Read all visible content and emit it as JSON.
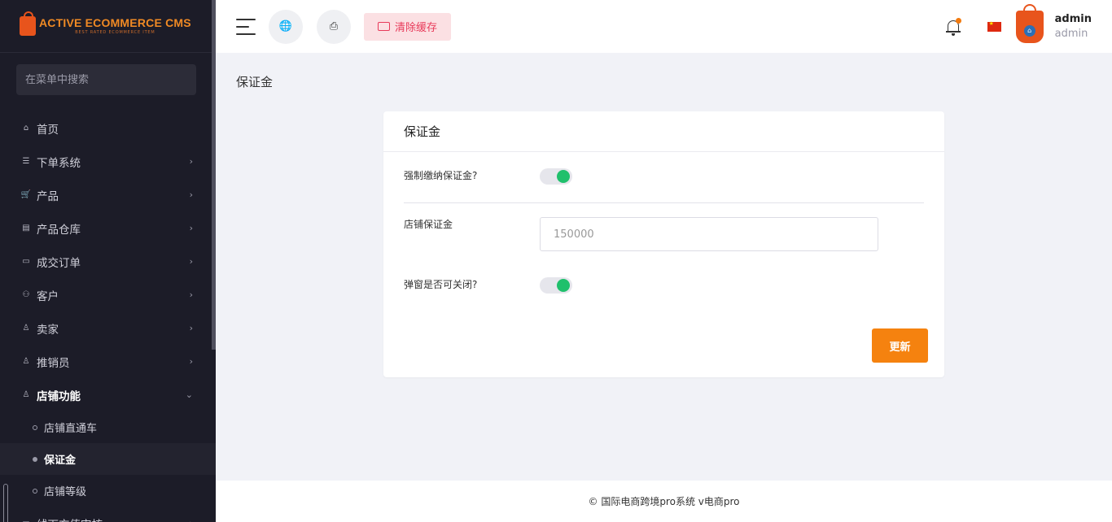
{
  "brand": {
    "title": "ACTIVE ECOMMERCE CMS",
    "tagline": "BEST RATED ECOMMERCE ITEM"
  },
  "sidebar": {
    "search_placeholder": "在菜单中搜索",
    "items": [
      {
        "label": "首页",
        "icon": "home-icon"
      },
      {
        "label": "下单系统",
        "icon": "list-icon"
      },
      {
        "label": "产品",
        "icon": "cart-icon"
      },
      {
        "label": "产品仓库",
        "icon": "warehouse-icon"
      },
      {
        "label": "成交订单",
        "icon": "money-icon"
      },
      {
        "label": "客户",
        "icon": "users-icon"
      },
      {
        "label": "卖家",
        "icon": "user-icon"
      },
      {
        "label": "推销员",
        "icon": "user-icon"
      },
      {
        "label": "店铺功能",
        "icon": "user-icon"
      },
      {
        "label": "线下充值审核",
        "icon": "money-icon"
      }
    ],
    "sub_items": [
      {
        "label": "店铺直通车"
      },
      {
        "label": "保证金"
      },
      {
        "label": "店铺等级"
      }
    ]
  },
  "header": {
    "clear_cache_label": "清除缓存",
    "user_name": "admin",
    "user_role": "admin",
    "icons": [
      "menu-icon",
      "globe-icon",
      "print-icon",
      "bell-icon",
      "flag-cn-icon"
    ]
  },
  "page": {
    "title": "保证金"
  },
  "card": {
    "title": "保证金",
    "force_deposit_label": "强制缴纳保证金?",
    "force_deposit_on": true,
    "shop_deposit_label": "店铺保证金",
    "shop_deposit_placeholder": "150000",
    "popup_closable_label": "弹窗是否可关闭?",
    "popup_closable_on": true,
    "update_label": "更新"
  },
  "footer": {
    "text": "© 国际电商跨境pro系统 v电商pro"
  },
  "colors": {
    "sidebar_bg": "#1c1c28",
    "accent_orange": "#f5820f",
    "toggle_green": "#20c06c",
    "danger_pink": "#e83a5a"
  }
}
